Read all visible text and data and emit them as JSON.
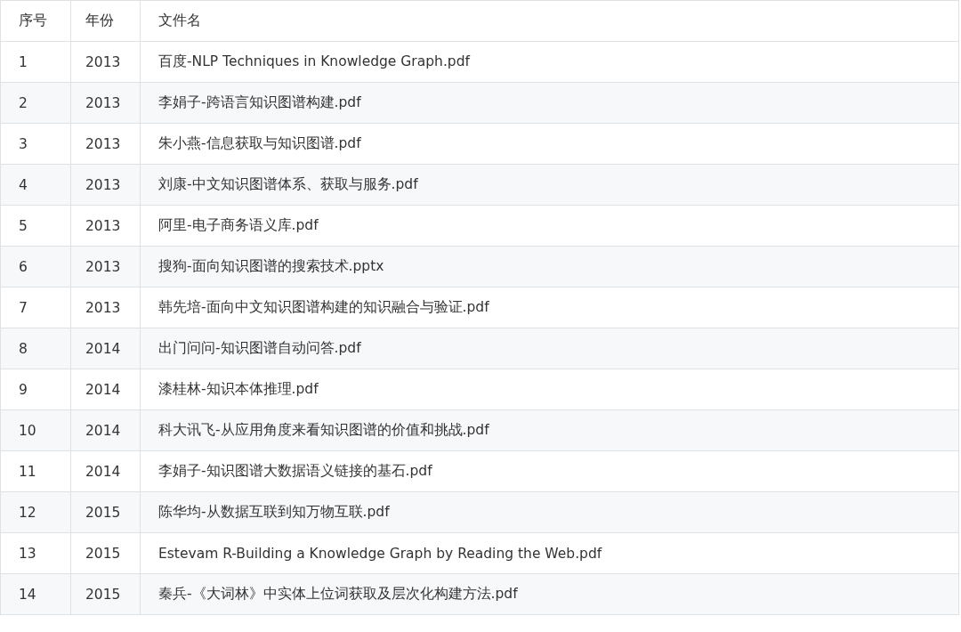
{
  "table": {
    "columns": [
      "序号",
      "年份",
      "文件名"
    ],
    "rows": [
      [
        "1",
        "2013",
        "百度-NLP Techniques in Knowledge Graph.pdf"
      ],
      [
        "2",
        "2013",
        "李娟子-跨语言知识图谱构建.pdf"
      ],
      [
        "3",
        "2013",
        "朱小燕-信息获取与知识图谱.pdf"
      ],
      [
        "4",
        "2013",
        "刘康-中文知识图谱体系、获取与服务.pdf"
      ],
      [
        "5",
        "2013",
        "阿里-电子商务语义库.pdf"
      ],
      [
        "6",
        "2013",
        "搜狗-面向知识图谱的搜索技术.pptx"
      ],
      [
        "7",
        "2013",
        "韩先培-面向中文知识图谱构建的知识融合与验证.pdf"
      ],
      [
        "8",
        "2014",
        "出门问问-知识图谱自动问答.pdf"
      ],
      [
        "9",
        "2014",
        "漆桂林-知识本体推理.pdf"
      ],
      [
        "10",
        "2014",
        "科大讯飞-从应用角度来看知识图谱的价值和挑战.pdf"
      ],
      [
        "11",
        "2014",
        "李娟子-知识图谱大数据语义链接的基石.pdf"
      ],
      [
        "12",
        "2015",
        "陈华均-从数据互联到知万物互联.pdf"
      ],
      [
        "13",
        "2015",
        "Estevam R-Building a Knowledge Graph by Reading the Web.pdf"
      ],
      [
        "14",
        "2015",
        "秦兵-《大词林》中实体上位词获取及层次化构建方法.pdf"
      ]
    ]
  }
}
